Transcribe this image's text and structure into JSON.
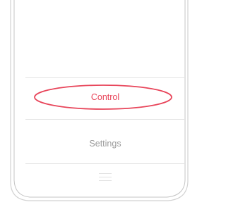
{
  "menu": {
    "items": [
      {
        "label": "Control",
        "highlighted": true
      },
      {
        "label": "Settings",
        "highlighted": false
      }
    ],
    "footer_icon": "hamburger-menu-icon"
  },
  "colors": {
    "accent": "#e8455a",
    "muted_text": "#9a9a9a",
    "divider": "#e3e3e3",
    "frame": "#c8c8c8"
  }
}
